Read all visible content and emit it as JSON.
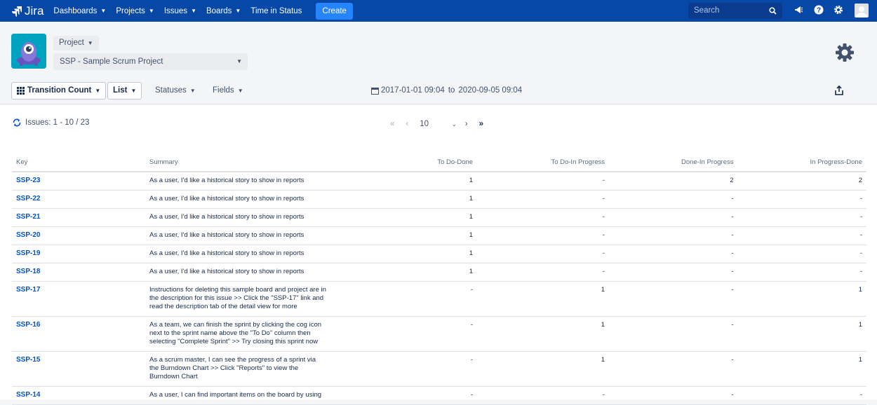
{
  "topnav": {
    "logo": "Jira",
    "items": [
      {
        "label": "Dashboards",
        "chevron": true
      },
      {
        "label": "Projects",
        "chevron": true
      },
      {
        "label": "Issues",
        "chevron": true
      },
      {
        "label": "Boards",
        "chevron": true
      },
      {
        "label": "Time in Status",
        "chevron": false
      }
    ],
    "create_label": "Create",
    "search_placeholder": "Search"
  },
  "header": {
    "project_label": "Project",
    "project_selected": "SSP - Sample Scrum Project"
  },
  "toolbar": {
    "report_type": "Transition Count",
    "view_mode": "List",
    "statuses_label": "Statuses",
    "fields_label": "Fields",
    "date_from": "2017-01-01 09:04",
    "date_to_word": "to",
    "date_to": "2020-09-05 09:04"
  },
  "listing": {
    "issues_count": "Issues: 1 - 10 / 23",
    "page_size": "10"
  },
  "table": {
    "columns": [
      "Key",
      "Summary",
      "To Do-Done",
      "To Do-In Progress",
      "Done-In Progress",
      "In Progress-Done"
    ],
    "rows": [
      {
        "key": "SSP-23",
        "summary": "As a user, I'd like a historical story to show in reports",
        "c1": "1",
        "c2": "-",
        "c3": "2",
        "c4": "2"
      },
      {
        "key": "SSP-22",
        "summary": "As a user, I'd like a historical story to show in reports",
        "c1": "1",
        "c2": "-",
        "c3": "-",
        "c4": "-"
      },
      {
        "key": "SSP-21",
        "summary": "As a user, I'd like a historical story to show in reports",
        "c1": "1",
        "c2": "-",
        "c3": "-",
        "c4": "-"
      },
      {
        "key": "SSP-20",
        "summary": "As a user, I'd like a historical story to show in reports",
        "c1": "1",
        "c2": "-",
        "c3": "-",
        "c4": "-"
      },
      {
        "key": "SSP-19",
        "summary": "As a user, I'd like a historical story to show in reports",
        "c1": "1",
        "c2": "-",
        "c3": "-",
        "c4": "-"
      },
      {
        "key": "SSP-18",
        "summary": "As a user, I'd like a historical story to show in reports",
        "c1": "1",
        "c2": "-",
        "c3": "-",
        "c4": "-"
      },
      {
        "key": "SSP-17",
        "summary": "Instructions for deleting this sample board and project are in the description for this issue >> Click the \"SSP-17\" link and read the description tab of the detail view for more",
        "c1": "-",
        "c2": "1",
        "c3": "-",
        "c4": "1"
      },
      {
        "key": "SSP-16",
        "summary": "As a team, we can finish the sprint by clicking the cog icon next to the sprint name above the \"To Do\" column then selecting \"Complete Sprint\" >> Try closing this sprint now",
        "c1": "-",
        "c2": "1",
        "c3": "-",
        "c4": "1"
      },
      {
        "key": "SSP-15",
        "summary": "As a scrum master, I can see the progress of a sprint via the Burndown Chart >> Click \"Reports\" to view the Burndown Chart",
        "c1": "-",
        "c2": "1",
        "c3": "-",
        "c4": "1"
      },
      {
        "key": "SSP-14",
        "summary": "As a user, I can find important items on the board by using",
        "c1": "-",
        "c2": "-",
        "c3": "-",
        "c4": "-"
      }
    ]
  }
}
